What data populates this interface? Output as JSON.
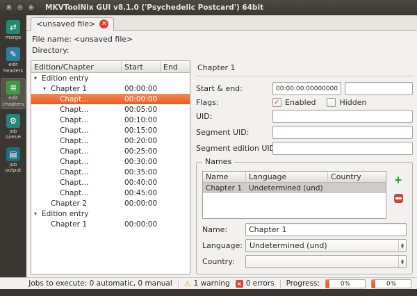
{
  "window": {
    "title": "MKVToolNix GUI v8.1.0 ('Psychedelic Postcard') 64bit"
  },
  "colors": {
    "selection_orange": "#E75A21",
    "tab_close_red": "#E23E2E",
    "progress_orange": "#E25A1E",
    "warning_yellow": "#E9A10E",
    "error_red": "#D6473B",
    "check_orange": "#DD4814"
  },
  "sidebar": {
    "items": [
      {
        "label": "merge",
        "icon": "merge-icon",
        "glyph": "⇄",
        "color": "#1F8A70",
        "active": false
      },
      {
        "label": "edit headers",
        "icon": "edit-headers-icon",
        "glyph": "✎",
        "color": "#2E7EA0",
        "active": false
      },
      {
        "label": "edit chapters",
        "icon": "edit-chapters-icon",
        "glyph": "≣",
        "color": "#3C9A46",
        "active": true
      },
      {
        "label": "job queue",
        "icon": "job-queue-icon",
        "glyph": "⚙",
        "color": "#23867B",
        "active": false
      },
      {
        "label": "job output",
        "icon": "job-output-icon",
        "glyph": "▤",
        "color": "#1F6E80",
        "active": false
      }
    ]
  },
  "tabbar": {
    "tab_label": "<unsaved file>"
  },
  "file_info": {
    "file_name_label": "File name:",
    "file_name_value": "<unsaved file>",
    "directory_label": "Directory:",
    "directory_value": ""
  },
  "tree": {
    "columns": [
      "Edition/Chapter",
      "Start",
      "End"
    ],
    "rows": [
      {
        "label": "Edition entry",
        "start": "",
        "end": "",
        "level": 0,
        "expander": true,
        "selected": false
      },
      {
        "label": "Chapter 1",
        "start": "00:00:00",
        "end": "",
        "level": 1,
        "expander": true,
        "selected": false
      },
      {
        "label": "Chapt…",
        "start": "00:00:00",
        "end": "",
        "level": 2,
        "expander": false,
        "selected": true
      },
      {
        "label": "Chapt…",
        "start": "00:05:00",
        "end": "",
        "level": 2,
        "expander": false,
        "selected": false
      },
      {
        "label": "Chapt…",
        "start": "00:10:00",
        "end": "",
        "level": 2,
        "expander": false,
        "selected": false
      },
      {
        "label": "Chapt…",
        "start": "00:15:00",
        "end": "",
        "level": 2,
        "expander": false,
        "selected": false
      },
      {
        "label": "Chapt…",
        "start": "00:20:00",
        "end": "",
        "level": 2,
        "expander": false,
        "selected": false
      },
      {
        "label": "Chapt…",
        "start": "00:25:00",
        "end": "",
        "level": 2,
        "expander": false,
        "selected": false
      },
      {
        "label": "Chapt…",
        "start": "00:30:00",
        "end": "",
        "level": 2,
        "expander": false,
        "selected": false
      },
      {
        "label": "Chapt…",
        "start": "00:35:00",
        "end": "",
        "level": 2,
        "expander": false,
        "selected": false
      },
      {
        "label": "Chapt…",
        "start": "00:40:00",
        "end": "",
        "level": 2,
        "expander": false,
        "selected": false
      },
      {
        "label": "Chapt…",
        "start": "00:45:00",
        "end": "",
        "level": 2,
        "expander": false,
        "selected": false
      },
      {
        "label": "Chapter 2",
        "start": "00:00:00",
        "end": "",
        "level": 1,
        "expander": false,
        "selected": false
      },
      {
        "label": "Edition entry",
        "start": "",
        "end": "",
        "level": 0,
        "expander": true,
        "selected": false
      },
      {
        "label": "Chapter 1",
        "start": "00:00:00",
        "end": "",
        "level": 1,
        "expander": false,
        "selected": false
      }
    ]
  },
  "chapter_panel": {
    "heading": "Chapter 1",
    "start_end_label": "Start & end:",
    "start_value": "00:00:00.000000000",
    "end_value": "",
    "flags_label": "Flags:",
    "enabled_label": "Enabled",
    "enabled_checked": true,
    "hidden_label": "Hidden",
    "hidden_checked": false,
    "uid_label": "UID:",
    "uid_value": "",
    "segment_uid_label": "Segment UID:",
    "segment_uid_value": "",
    "segment_edition_uid_label": "Segment edition UID:",
    "segment_edition_uid_value": ""
  },
  "names": {
    "group_title": "Names",
    "columns": [
      "Name",
      "Language",
      "Country"
    ],
    "rows": [
      {
        "name": "Chapter 1",
        "language": "Undetermined (und)",
        "country": "",
        "selected": true
      }
    ],
    "name_label": "Name:",
    "name_value": "Chapter 1",
    "language_label": "Language:",
    "language_value": "Undetermined (und)",
    "country_label": "Country:",
    "country_value": ""
  },
  "statusbar": {
    "jobs_text": "Jobs to execute: 0 automatic, 0 manual",
    "warning_text": "1 warning",
    "errors_text": "0 errors",
    "progress_label": "Progress:",
    "progress1": "0%",
    "progress2": "0%"
  }
}
